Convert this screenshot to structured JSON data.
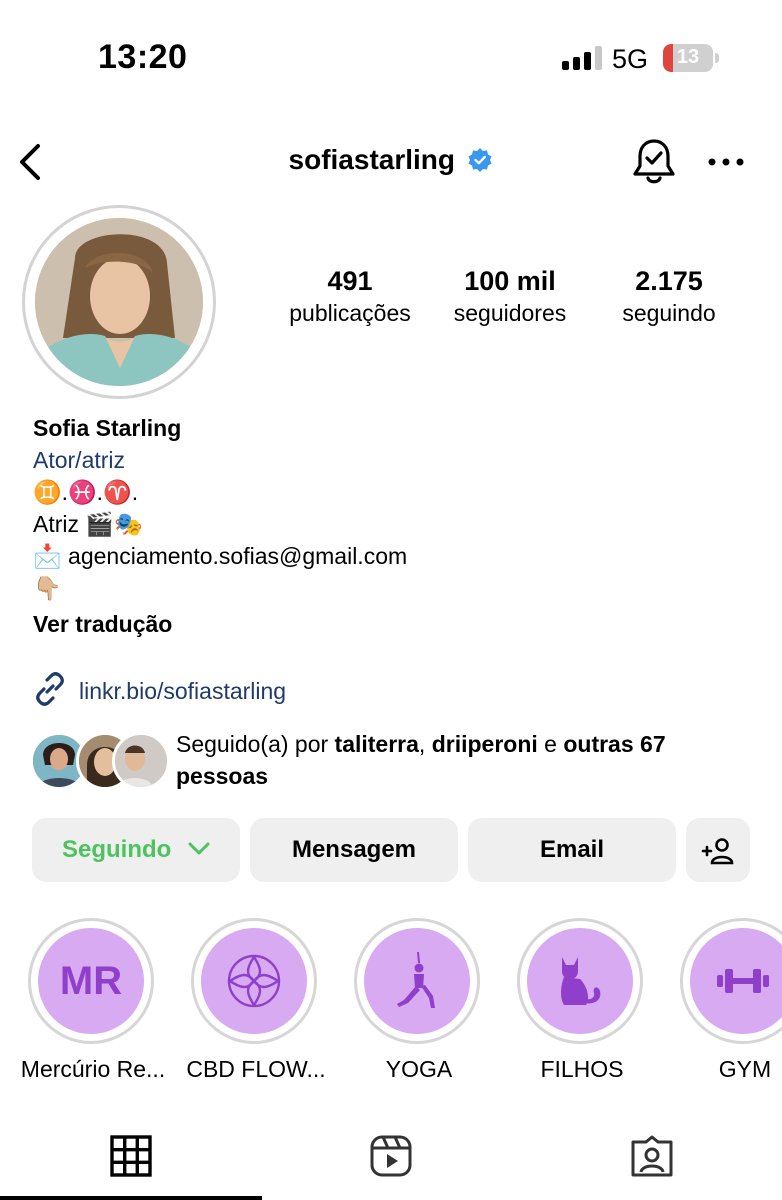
{
  "status_bar": {
    "time": "13:20",
    "network": "5G",
    "battery": "13",
    "battery_color": "#e0443e"
  },
  "header": {
    "username": "sofiastarling",
    "verified": true,
    "icons": [
      "back-arrow-icon",
      "verified-badge-icon",
      "notification-bell-icon",
      "more-options-icon"
    ]
  },
  "profile": {
    "stats": [
      {
        "value": "491",
        "label": "publicações"
      },
      {
        "value": "100 mil",
        "label": "seguidores"
      },
      {
        "value": "2.175",
        "label": "seguindo"
      }
    ],
    "name": "Sofia Starling",
    "category": "Ator/atriz",
    "bio_lines": [
      "♊️.♓️.♈️.",
      "Atriz 🎬🎭",
      "📩 agenciamento.sofias@gmail.com",
      "👇🏼"
    ],
    "translate_label": "Ver tradução",
    "link": "linkr.bio/sofiastarling",
    "followed_by": {
      "prefix": "Seguido(a) por ",
      "user1": "taliterra",
      "sep": ", ",
      "user2": "driiperoni",
      "conj": " e ",
      "others": "outras 67 pessoas"
    }
  },
  "actions": {
    "following_label": "Seguindo",
    "message_label": "Mensagem",
    "email_label": "Email",
    "following_color": "#4cc35e"
  },
  "highlights": [
    {
      "label": "Mercúrio Re...",
      "cover": "MR"
    },
    {
      "label": "CBD FLOW...",
      "cover": "cbd-flower-icon"
    },
    {
      "label": "YOGA",
      "cover": "yoga-pose-icon"
    },
    {
      "label": "FILHOS",
      "cover": "cat-icon"
    },
    {
      "label": "GYM",
      "cover": "dumbbell-icon"
    }
  ],
  "highlight_color": "#d7aaf2",
  "highlight_icon_color": "#8f3fc9",
  "tabs": [
    "grid-icon",
    "reels-icon",
    "tagged-icon"
  ],
  "link_color": "#1f3a6b"
}
